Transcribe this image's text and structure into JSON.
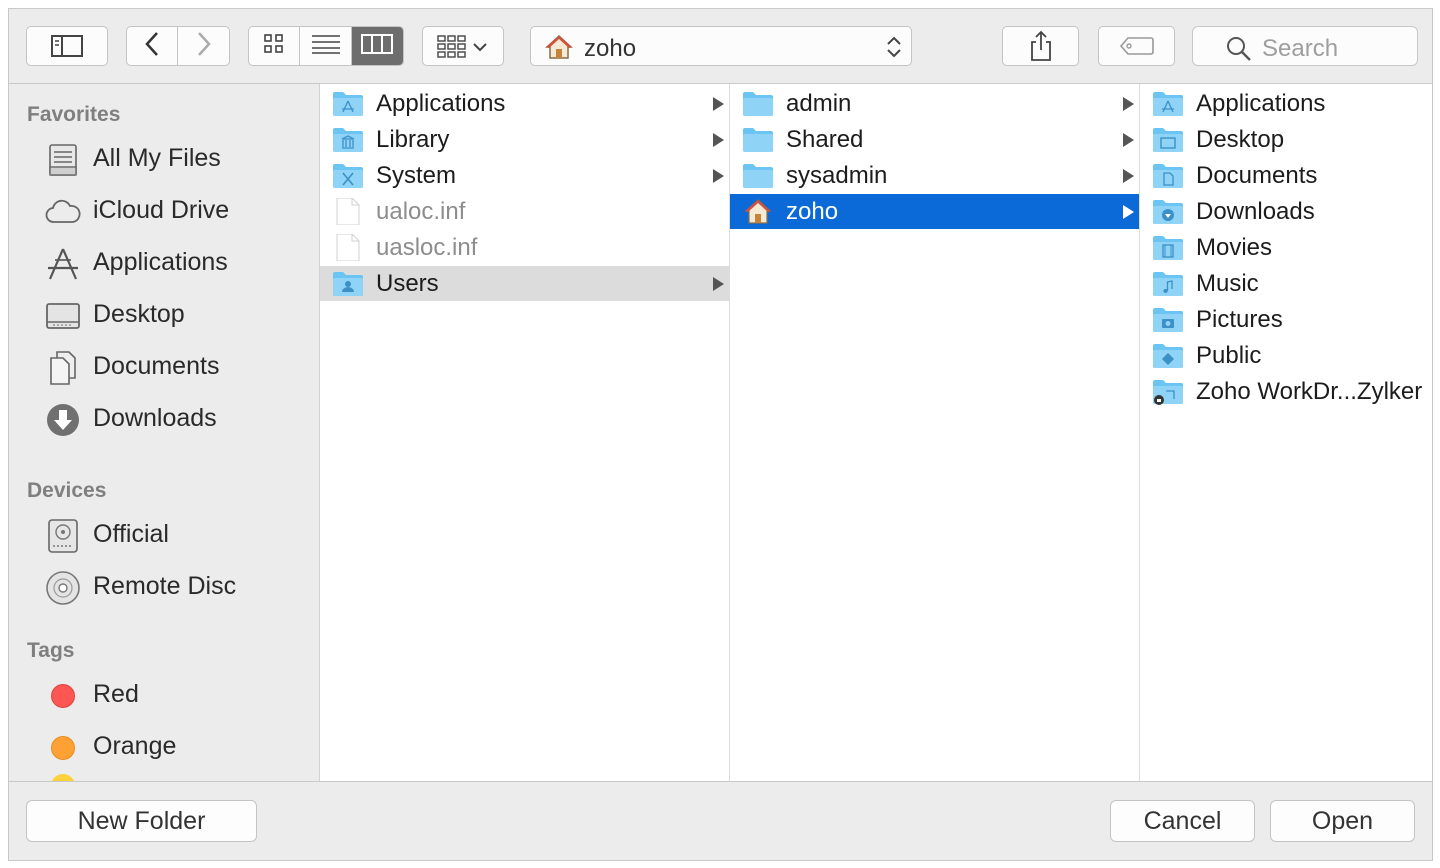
{
  "toolbar": {
    "path_label": "zoho",
    "search_placeholder": "Search"
  },
  "sidebar": {
    "favorites_header": "Favorites",
    "favorites": [
      {
        "label": "All My Files",
        "icon": "all-my-files-icon"
      },
      {
        "label": "iCloud Drive",
        "icon": "cloud-icon"
      },
      {
        "label": "Applications",
        "icon": "applications-icon"
      },
      {
        "label": "Desktop",
        "icon": "desktop-icon"
      },
      {
        "label": "Documents",
        "icon": "documents-icon"
      },
      {
        "label": "Downloads",
        "icon": "downloads-icon"
      }
    ],
    "devices_header": "Devices",
    "devices": [
      {
        "label": "Official",
        "icon": "hard-drive-icon"
      },
      {
        "label": "Remote Disc",
        "icon": "disc-icon"
      }
    ],
    "tags_header": "Tags",
    "tags": [
      {
        "label": "Red",
        "color": "#fc5753"
      },
      {
        "label": "Orange",
        "color": "#fda135"
      }
    ]
  },
  "columns": {
    "col1": [
      {
        "label": "Applications",
        "kind": "folder-apps",
        "has_children": true
      },
      {
        "label": "Library",
        "kind": "folder-library",
        "has_children": true
      },
      {
        "label": "System",
        "kind": "folder-system",
        "has_children": true
      },
      {
        "label": "ualoc.inf",
        "kind": "file",
        "has_children": false
      },
      {
        "label": "uasloc.inf",
        "kind": "file",
        "has_children": false
      },
      {
        "label": "Users",
        "kind": "folder-users",
        "has_children": true,
        "selected": "inactive"
      }
    ],
    "col2": [
      {
        "label": "admin",
        "kind": "folder",
        "has_children": true
      },
      {
        "label": "Shared",
        "kind": "folder",
        "has_children": true
      },
      {
        "label": "sysadmin",
        "kind": "folder",
        "has_children": true
      },
      {
        "label": "zoho",
        "kind": "home",
        "has_children": true,
        "selected": "active"
      }
    ],
    "col3": [
      {
        "label": "Applications",
        "kind": "folder-apps"
      },
      {
        "label": "Desktop",
        "kind": "folder-desktop"
      },
      {
        "label": "Documents",
        "kind": "folder-documents"
      },
      {
        "label": "Downloads",
        "kind": "folder-downloads"
      },
      {
        "label": "Movies",
        "kind": "folder-movies"
      },
      {
        "label": "Music",
        "kind": "folder-music"
      },
      {
        "label": "Pictures",
        "kind": "folder-pictures"
      },
      {
        "label": "Public",
        "kind": "folder-public"
      },
      {
        "label": "Zoho WorkDr...Zylker",
        "kind": "folder-shared"
      }
    ]
  },
  "buttons": {
    "new_folder": "New Folder",
    "cancel": "Cancel",
    "open": "Open"
  },
  "colors": {
    "selection_blue": "#0b6ad8",
    "folder_blue": "#6cc4f2"
  }
}
